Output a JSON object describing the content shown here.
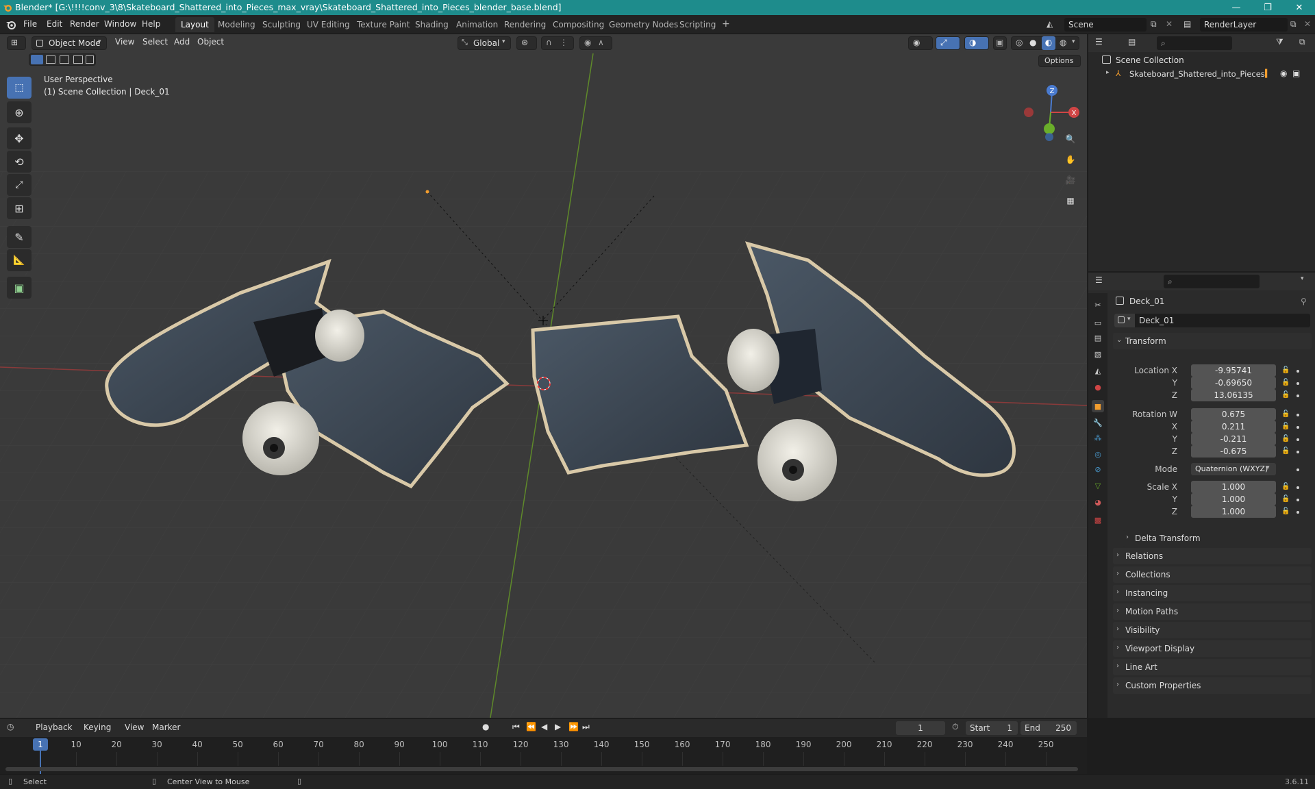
{
  "titlebar": {
    "title": "Blender* [G:\\!!!!conv_3\\8\\Skateboard_Shattered_into_Pieces_max_vray\\Skateboard_Shattered_into_Pieces_blender_base.blend]",
    "minimize": "—",
    "maximize": "❐",
    "close": "✕"
  },
  "menu": {
    "items": [
      "File",
      "Edit",
      "Render",
      "Window",
      "Help"
    ]
  },
  "workspaces": {
    "tabs": [
      "Layout",
      "Modeling",
      "Sculpting",
      "UV Editing",
      "Texture Paint",
      "Shading",
      "Animation",
      "Rendering",
      "Compositing",
      "Geometry Nodes",
      "Scripting"
    ],
    "add": "+"
  },
  "scene": {
    "name": "Scene",
    "render_layer": "RenderLayer"
  },
  "viewport": {
    "mode": "Object Mode",
    "menus": [
      "View",
      "Select",
      "Add",
      "Object"
    ],
    "orientation": "Global",
    "options": "Options",
    "perspective": "User Perspective",
    "collection_info": "(1) Scene Collection | Deck_01",
    "gizmo": {
      "z": "Z",
      "x": "X"
    }
  },
  "outliner": {
    "root": "Scene Collection",
    "items": [
      "Skateboard_Shattered_into_Pieces"
    ]
  },
  "properties": {
    "object_name": "Deck_01",
    "data_name": "Deck_01",
    "transform_title": "Transform",
    "location": {
      "label": "Location X",
      "x": "-9.95741",
      "y": "-0.69650",
      "z": "13.06135"
    },
    "rotation": {
      "label": "Rotation W",
      "w": "0.675",
      "x": "0.211",
      "y": "-0.211",
      "z": "-0.675"
    },
    "mode_label": "Mode",
    "mode_value": "Quaternion (WXYZ)",
    "scale": {
      "label": "Scale X",
      "x": "1.000",
      "y": "1.000",
      "z": "1.000"
    },
    "axis_labels": {
      "x": "X",
      "y": "Y",
      "z": "Z"
    },
    "delta_transform": "Delta Transform",
    "panels": [
      "Relations",
      "Collections",
      "Instancing",
      "Motion Paths",
      "Visibility",
      "Viewport Display",
      "Line Art",
      "Custom Properties"
    ]
  },
  "timeline": {
    "menus": [
      "Playback",
      "Keying",
      "View",
      "Marker"
    ],
    "current_frame": "1",
    "start_label": "Start",
    "start": "1",
    "end_label": "End",
    "end": "250",
    "ruler_current": "1",
    "ruler": [
      "10",
      "20",
      "30",
      "40",
      "50",
      "60",
      "70",
      "80",
      "90",
      "100",
      "110",
      "120",
      "130",
      "140",
      "150",
      "160",
      "170",
      "180",
      "190",
      "200",
      "210",
      "220",
      "230",
      "240",
      "250"
    ]
  },
  "statusbar": {
    "select": "Select",
    "center_view": "Center View to Mouse",
    "version": "3.6.11"
  },
  "colors": {
    "titlebar": "#1e8c8c",
    "accent": "#4772b3",
    "axis_x": "#c0392b",
    "axis_y": "#6a9e2a",
    "active_object": "#f29d2e"
  }
}
